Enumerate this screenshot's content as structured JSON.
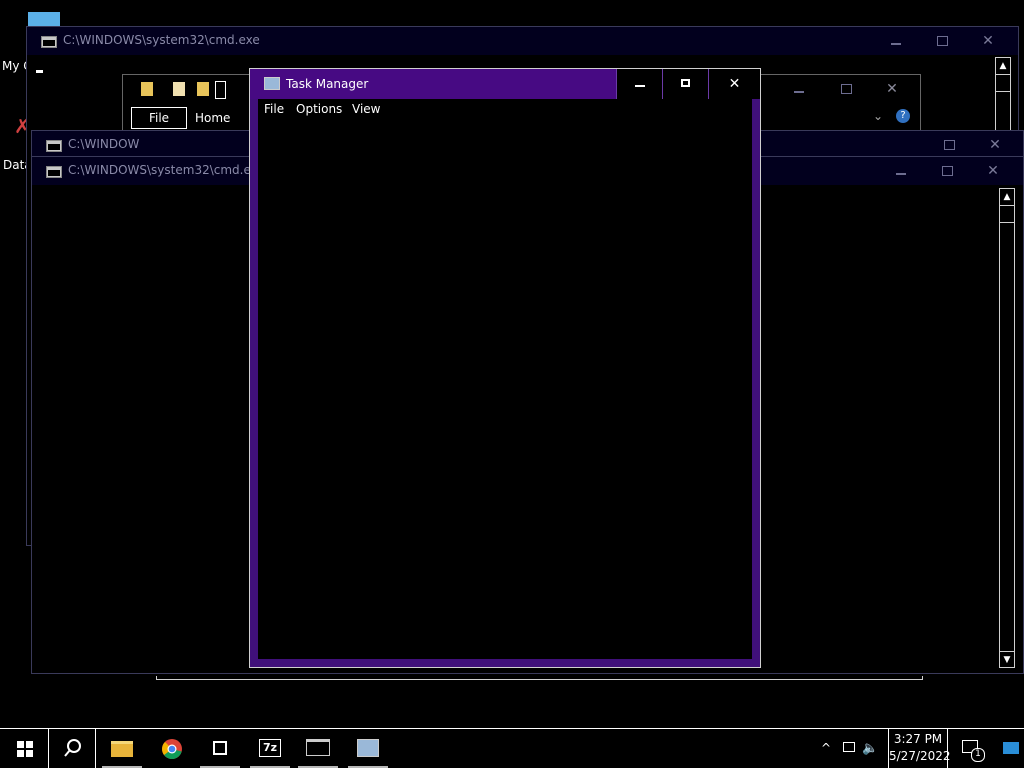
{
  "desktop": {
    "icons": [
      {
        "label": "My C",
        "icon": "computer-icon"
      },
      {
        "label": "Data",
        "icon": "database-icon"
      }
    ]
  },
  "windows": {
    "cmd_back": {
      "title": "C:\\WINDOWS\\system32\\cmd.exe",
      "icon": "cmd-icon"
    },
    "cmd_middle": {
      "title": "C:\\WINDOW",
      "icon": "cmd-icon"
    },
    "cmd_front": {
      "title": "C:\\WINDOWS\\system32\\cmd.exe",
      "icon": "cmd-icon"
    },
    "explorer": {
      "ribbon_tabs": [
        "File",
        "Home"
      ],
      "icons": [
        "folder-icon",
        "properties-icon",
        "new-folder-icon",
        "customize-icon"
      ]
    }
  },
  "task_manager": {
    "title": "Task Manager",
    "menu": [
      "File",
      "Options",
      "View"
    ],
    "accent": "#470a83"
  },
  "controls": {
    "minimize": "—",
    "maximize": "☐",
    "close": "✕"
  },
  "taskbar": {
    "apps": [
      "start-icon",
      "search-icon",
      "file-explorer-icon",
      "chrome-icon",
      "store-icon",
      "7zip-icon",
      "cmd-icon",
      "task-manager-icon"
    ],
    "seven_zip_label": "7z",
    "time": "3:27 PM",
    "date": "5/27/2022",
    "notification_count": "1"
  }
}
